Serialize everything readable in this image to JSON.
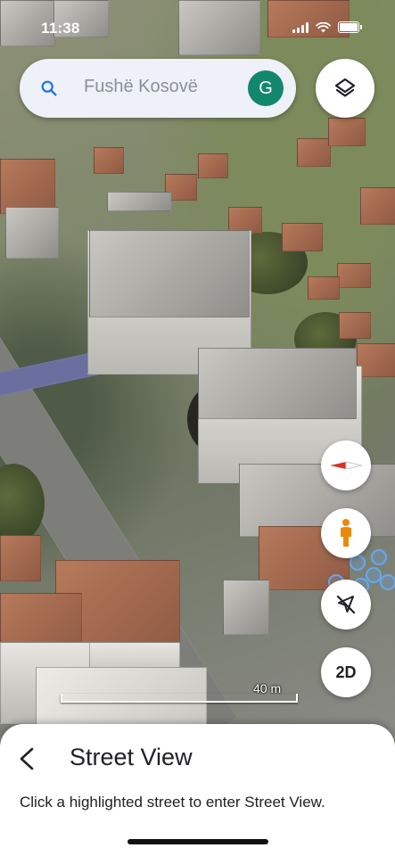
{
  "status_bar": {
    "time": "11:38"
  },
  "search": {
    "placeholder": "Fushë Kosovë",
    "avatar_initial": "G",
    "icon": "search-icon"
  },
  "controls": {
    "layers_icon": "layers-icon",
    "compass_icon": "compass-icon",
    "pegman_icon": "pegman-icon",
    "recenter_icon": "location-off-icon",
    "view_mode_label": "2D"
  },
  "map": {
    "scale_label": "40 m"
  },
  "sheet": {
    "title": "Street View",
    "description": "Click a highlighted street to enter Street View.",
    "back_icon": "back-arrow-icon"
  },
  "colors": {
    "avatar_bg": "#13866e",
    "pegman": "#e8890c",
    "compass_red": "#d93025",
    "streetview_blue": "#64a9f0"
  }
}
